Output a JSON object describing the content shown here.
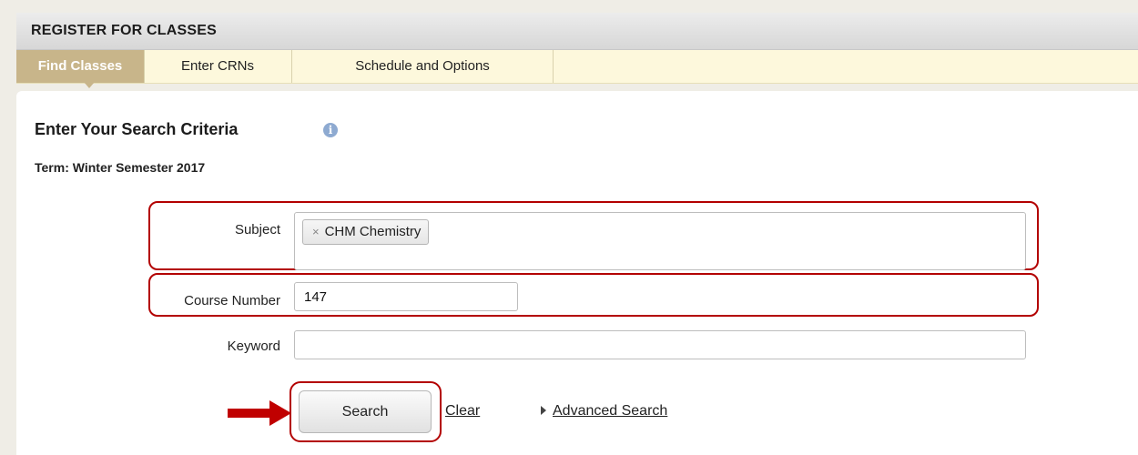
{
  "header": {
    "title": "REGISTER FOR CLASSES"
  },
  "tabs": [
    {
      "label": "Find Classes",
      "active": true
    },
    {
      "label": "Enter CRNs",
      "active": false
    },
    {
      "label": "Schedule and Options",
      "active": false
    }
  ],
  "search": {
    "title": "Enter Your Search Criteria",
    "info_icon": "info-icon",
    "term": "Term: Winter Semester 2017"
  },
  "fields": {
    "subject": {
      "label": "Subject",
      "chip_remove_symbol": "×",
      "chip_label": "CHM Chemistry"
    },
    "course_number": {
      "label": "Course Number",
      "value": "147"
    },
    "keyword": {
      "label": "Keyword",
      "value": ""
    }
  },
  "actions": {
    "search_label": "Search",
    "clear_label": "Clear",
    "advanced_label": "Advanced Search"
  },
  "colors": {
    "highlight": "#b30000",
    "active_tab": "#c8b58a",
    "tab_row": "#fdf8dc",
    "page_bg": "#efede6",
    "info_icon": "#8eaad1"
  }
}
